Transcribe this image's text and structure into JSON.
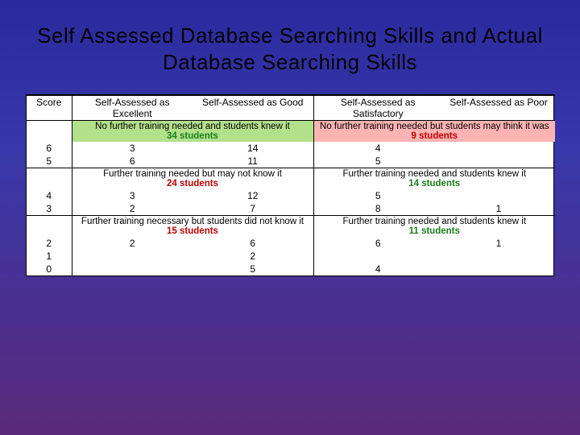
{
  "title": "Self Assessed Database Searching Skills and Actual Database Searching Skills",
  "headers": {
    "score": "Score",
    "excellent": "Self-Assessed as Excellent",
    "good": "Self-Assessed as Good",
    "satisfactory": "Self-Assessed as Satisfactory",
    "poor": "Self-Assessed as  Poor"
  },
  "bands": {
    "topLeft": {
      "msg": "No further training needed and students knew it",
      "count": "34 students"
    },
    "topRight": {
      "msg": "No further training needed but students may think it was",
      "count": "9 students"
    },
    "midLeft": {
      "msg": "Further training needed but may not know it",
      "count": "24 students"
    },
    "midRight": {
      "msg": "Further training needed and students knew it",
      "count": "14 students"
    },
    "botLeft": {
      "msg": "Further training necessary but students did not know it",
      "count": "15 students"
    },
    "botRight": {
      "msg": "Further training needed and students knew it",
      "count": "11 students"
    }
  },
  "scores": {
    "s6": "6",
    "s5": "5",
    "s4": "4",
    "s3": "3",
    "s2": "2",
    "s1": "1",
    "s0": "0"
  },
  "cells": {
    "r6": {
      "ex": "3",
      "gd": "14",
      "sa": "4",
      "pr": ""
    },
    "r5": {
      "ex": "6",
      "gd": "11",
      "sa": "5",
      "pr": ""
    },
    "r4": {
      "ex": "3",
      "gd": "12",
      "sa": "5",
      "pr": ""
    },
    "r3": {
      "ex": "2",
      "gd": "7",
      "sa": "8",
      "pr": "1"
    },
    "r2": {
      "ex": "2",
      "gd": "6",
      "sa": "6",
      "pr": "1"
    },
    "r1": {
      "ex": "",
      "gd": "2",
      "sa": "",
      "pr": ""
    },
    "r0": {
      "ex": "",
      "gd": "5",
      "sa": "4",
      "pr": ""
    }
  }
}
